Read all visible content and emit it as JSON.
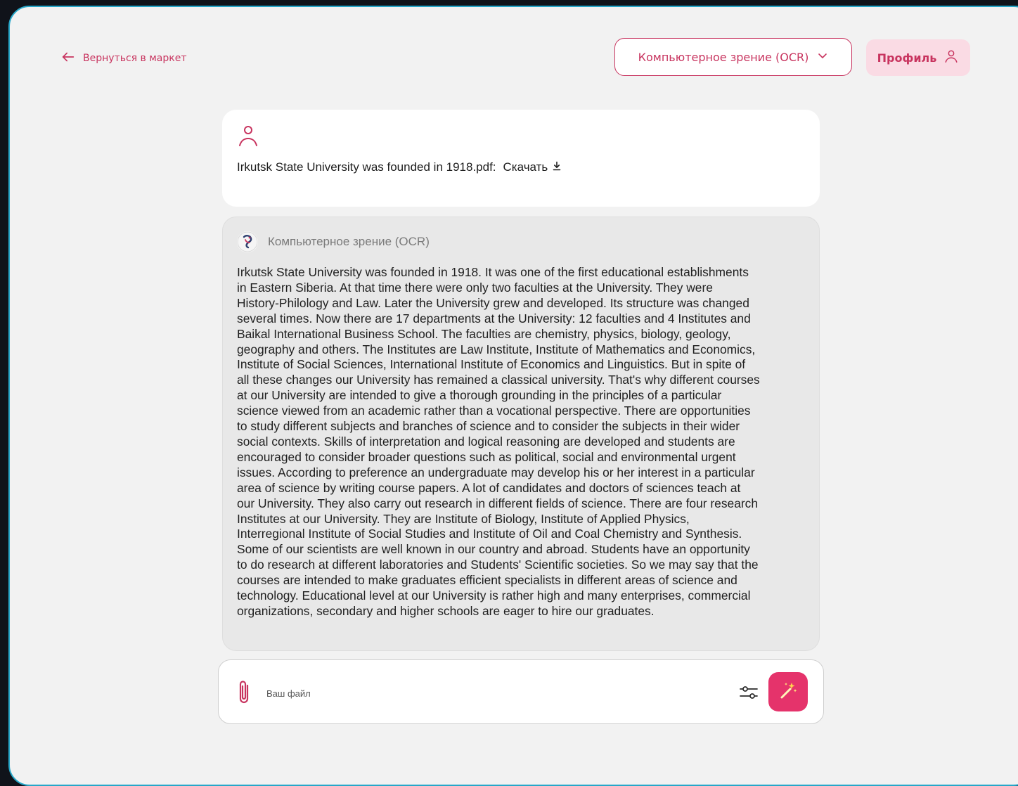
{
  "header": {
    "back_label": "Вернуться в маркет",
    "model_selected": "Компьютерное зрение (OCR)",
    "profile_label": "Профиль"
  },
  "user_message": {
    "file_name": "Irkutsk State University was founded in 1918.pdf:",
    "download_label": "Скачать"
  },
  "bot_message": {
    "name": "Компьютерное зрение (OCR)",
    "lines": [
      "Irkutsk State University was founded in 1918. It was one of the first educational establishments",
      "in Eastern Siberia. At that time there were only two faculties at the University. They were",
      "History-Philology and Law. Later the University grew and developed. Its structure was changed",
      "several times. Now there are 17 departments at the University: 12 faculties and 4 Institutes and",
      "Baikal International Business School. The faculties are chemistry, physics, biology, geology,",
      "geography and others. The Institutes are Law Institute, Institute of Mathematics and Economics,",
      "Institute of Social Sciences, International Institute of Economics and Linguistics. But in spite of",
      "all these changes our University has remained a classical university. That's why different courses",
      "at our University are intended to give a thorough grounding in the principles of a particular",
      "science viewed from an academic rather than a vocational perspective. There are opportunities",
      "to study different subjects and branches of science and to consider the subjects in their wider",
      "social contexts. Skills of interpretation and logical reasoning are developed and students are",
      "encouraged to consider broader questions such as political, social and environmental urgent",
      "issues. According to preference an undergraduate may develop his or her interest in a particular",
      "area of science by writing course papers. A lot of candidates and doctors of sciences teach at",
      "our University. They also carry out research in different fields of science. There are four research",
      "Institutes at our University. They are Institute of Biology, Institute of Applied Physics,",
      "Interregional Institute of Social Studies and Institute of Oil and Coal Chemistry and Synthesis.",
      "Some of our scientists are well known in our country and abroad. Students have an opportunity",
      "to do research at different laboratories and Students' Scientific societies. So we may say that the",
      "courses are intended to make graduates efficient specialists in different areas of science and",
      "technology. Educational level at our University is rather high and many enterprises, commercial",
      "organizations, secondary and higher schools are eager to hire our graduates."
    ]
  },
  "composer": {
    "placeholder": "Ваш файл",
    "value": ""
  },
  "icons": {
    "back": "arrow-left-icon",
    "dropdown": "chevron-down-icon",
    "profile": "user-icon",
    "user_avatar": "user-icon",
    "bot_avatar": "bot-logo-icon",
    "download": "download-icon",
    "attach": "paperclip-icon",
    "settings": "sliders-icon",
    "send": "magic-wand-icon"
  },
  "colors": {
    "accent": "#c8345f",
    "send_button": "#e5336b",
    "profile_bg": "#fadbe4",
    "frame_border": "#27a7c9",
    "page_bg": "#f2f2f2"
  }
}
